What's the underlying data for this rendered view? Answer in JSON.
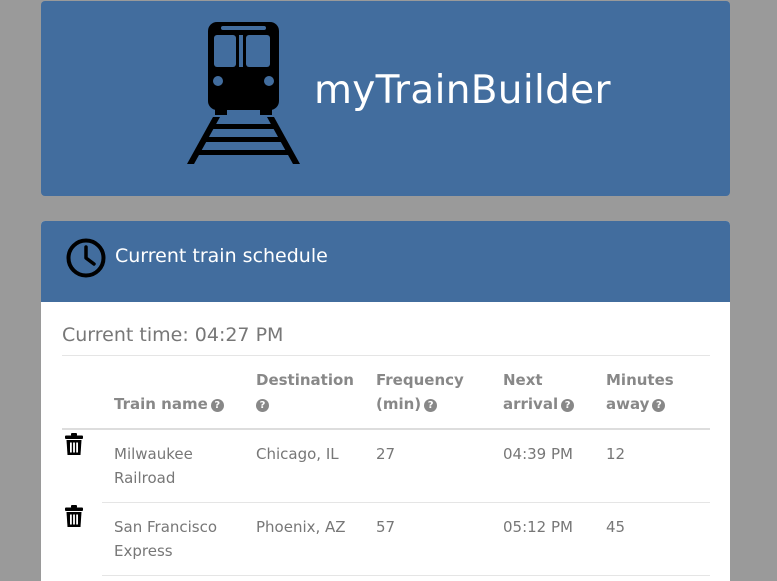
{
  "header": {
    "title": "myTrainBuilder",
    "logo_icon": "train-icon",
    "background": "#426d9e"
  },
  "schedule": {
    "heading": "Current train schedule",
    "heading_icon": "clock-icon",
    "current_time": "Current time: 04:27 PM",
    "columns": {
      "train_name": "Train name",
      "destination": "Destination",
      "frequency_line1": "Frequency",
      "frequency_line2": "(min)",
      "next_arrival_line1": "Next",
      "next_arrival_line2": "arrival",
      "minutes_away_line1": "Minutes",
      "minutes_away_line2": "away",
      "help_icon": "question-circle-icon"
    },
    "rows": [
      {
        "name_line1": "Milwaukee",
        "name_line2": "Railroad",
        "destination": "Chicago, IL",
        "frequency": "27",
        "next_arrival": "04:39 PM",
        "minutes_away": "12",
        "delete_icon": "trash-icon"
      },
      {
        "name_line1": "San Francisco",
        "name_line2": "Express",
        "destination": "Phoenix, AZ",
        "frequency": "57",
        "next_arrival": "05:12 PM",
        "minutes_away": "45",
        "delete_icon": "trash-icon"
      }
    ]
  }
}
